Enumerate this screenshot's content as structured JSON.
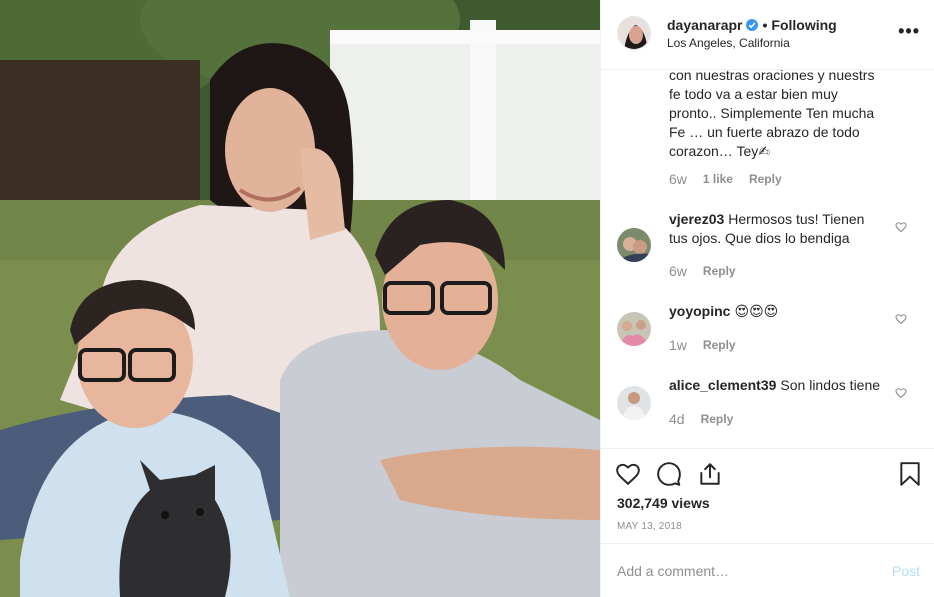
{
  "post": {
    "username": "dayanarapr",
    "separator": "•",
    "follow_status": "Following",
    "location": "Los Angeles, California",
    "more_label": "•••"
  },
  "caption_tail": {
    "text": "con nuestras oraciones y nuestrs fe todo va a estar bien muy pronto.. Simplemente Ten mucha Fe … un fuerte abrazo de todo corazon… Tey✍",
    "age": "6w",
    "likes": "1 like",
    "reply": "Reply"
  },
  "comments": [
    {
      "username": "vjerez03",
      "text": "Hermosos tus! Tienen tus ojos. Que dios lo bendiga",
      "age": "6w",
      "reply": "Reply"
    },
    {
      "username": "yoyopinc",
      "text": "😍😍😍",
      "age": "1w",
      "reply": "Reply"
    },
    {
      "username": "alice_clement39",
      "text": "Son lindos tiene",
      "age": "4d",
      "reply": "Reply"
    }
  ],
  "stats": {
    "views": "302,749 views",
    "date": "MAY 13, 2018"
  },
  "add_comment": {
    "placeholder": "Add a comment…",
    "post_label": "Post"
  },
  "colors": {
    "verified": "#3897f0",
    "post_disabled": "#b2dffc",
    "muted": "#8e8e8e"
  }
}
